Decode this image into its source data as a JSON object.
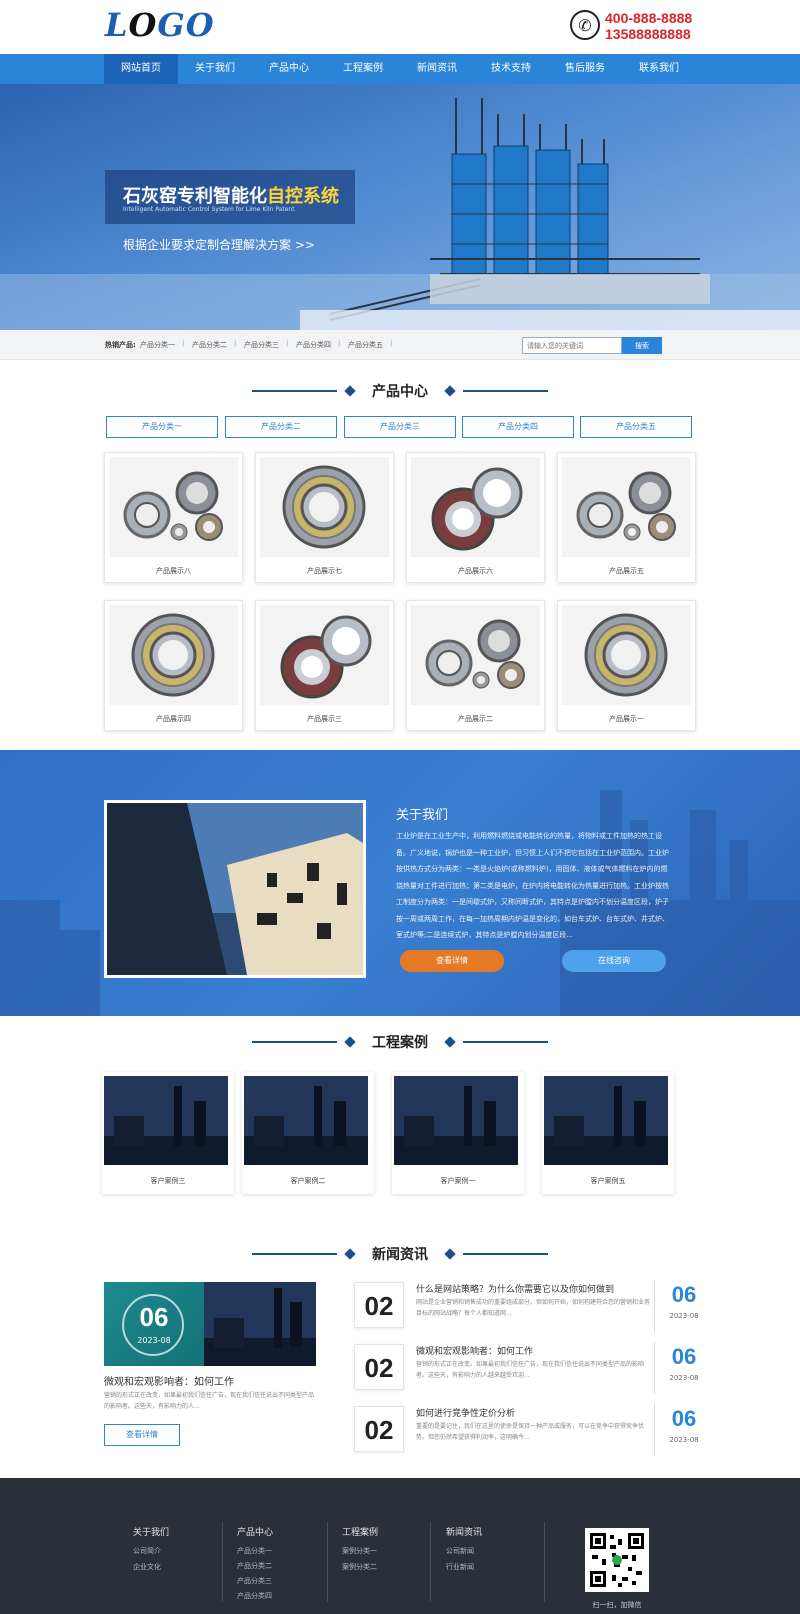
{
  "header": {
    "logo_part1": "L",
    "logo_part2": "O",
    "logo_part3": "GO",
    "phone_1": "400-888-8888",
    "phone_2": "13588888888"
  },
  "nav": [
    "网站首页",
    "关于我们",
    "产品中心",
    "工程案例",
    "新闻资讯",
    "技术支持",
    "售后服务",
    "联系我们"
  ],
  "banner": {
    "title_part1": "石灰窑专利智能化",
    "title_part2": "自控系统",
    "subtitle": "Intelligent Automatic Control System for Lime Kiln Patent",
    "slogan": "根据企业要求定制合理解决方案 >>"
  },
  "hot_search": {
    "label": "热销产品:",
    "links": [
      "产品分类一",
      "产品分类二",
      "产品分类三",
      "产品分类四",
      "产品分类五"
    ],
    "search_placeholder": "请输入您的关键词",
    "search_button": "搜索"
  },
  "products": {
    "title": "产品中心",
    "categories": [
      "产品分类一",
      "产品分类二",
      "产品分类三",
      "产品分类四",
      "产品分类五"
    ],
    "items": [
      "产品展示八",
      "产品展示七",
      "产品展示六",
      "产品展示五",
      "产品展示四",
      "产品展示三",
      "产品展示二",
      "产品展示一"
    ]
  },
  "about": {
    "title": "关于我们",
    "text": "工业炉是在工业生产中，利用燃料燃烧或电能转化的热量，将物料或工件加热的热工设备。广义地说，锅炉也是一种工业炉，但习惯上人们不把它包括在工业炉范围内。工业炉按供热方式分为两类：一类是火焰炉(或称燃料炉)，用固体、液体或气体燃料在炉内的燃烧热量对工件进行加热；第二类是电炉，在炉内将电能转化为热量进行加热。工业炉按热工制度分为两类：一是间歇式炉，又称间断式炉，其特点是炉膛内不划分温度区段，炉子按一周或两周工作，在每一加热周期内炉温是变化的，如台车式炉、台车式炉、井式炉、室式炉等;二是连续式炉，其特点是炉膛内划分温度区段...",
    "more_label": "查看详情",
    "consult_label": "在线咨询"
  },
  "cases": {
    "title": "工程案例",
    "items": [
      "客户案例三",
      "客户案例二",
      "客户案例一",
      "客户案例五"
    ]
  },
  "news": {
    "title": "新闻资讯",
    "featured": {
      "day": "06",
      "month": "2023-08",
      "title": "微观和宏观影响者：如何工作",
      "desc": "营销的形式正在改变，如果最初我们信任广告，现在我们信任说出不同类型产品的影响者。这些天，有影响力的人...",
      "more_label": "查看详情"
    },
    "items": [
      {
        "num": "02",
        "title": "什么是网站策略？为什么你需要它以及你如何做到",
        "desc": "网站是企业营销和销售成功的重要组成部分。但如何开始，如何构建符合您的营销和业务目标的网站战略？每个人都知道网...",
        "day": "06",
        "ym": "2023-08"
      },
      {
        "num": "02",
        "title": "微观和宏观影响者：如何工作",
        "desc": "营销的形式正在改变。如果最初我们信任广告，现在我们信任说出不同类型产品的影响者。这些天，有影响力的人越来越受欢迎...",
        "day": "06",
        "ym": "2023-08"
      },
      {
        "num": "02",
        "title": "如何进行竞争性定价分析",
        "desc": "重要的是要记住，我们在这里的使命是保持一种产品或服务，可以在竞争中获得竞争优势。但您仍然希望获得利润率，这明确今...",
        "day": "06",
        "ym": "2023-08"
      }
    ]
  },
  "footer": {
    "columns": [
      {
        "title": "关于我们",
        "links": [
          "公司简介",
          "企业文化"
        ]
      },
      {
        "title": "产品中心",
        "links": [
          "产品分类一",
          "产品分类二",
          "产品分类三",
          "产品分类四"
        ]
      },
      {
        "title": "工程案例",
        "links": [
          "案例分类一",
          "案例分类二"
        ]
      },
      {
        "title": "新闻资讯",
        "links": [
          "公司新闻",
          "行业新闻"
        ]
      }
    ],
    "qr_caption": "扫一扫，加微信"
  }
}
